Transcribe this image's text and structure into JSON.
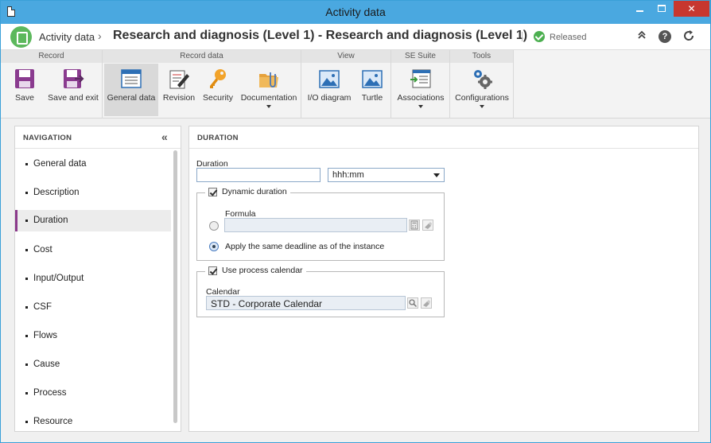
{
  "window": {
    "title": "Activity data"
  },
  "header": {
    "breadcrumb_root": "Activity data",
    "breadcrumb_sep": "›",
    "page_title": "Research and diagnosis (Level 1) - Research and diagnosis (Level 1)",
    "status": "Released"
  },
  "ribbon": {
    "groups": {
      "record": "Record",
      "record_data": "Record data",
      "view": "View",
      "se_suite": "SE Suite",
      "tools": "Tools"
    },
    "buttons": {
      "save": "Save",
      "save_exit": "Save and exit",
      "general_data": "General data",
      "revision": "Revision",
      "security": "Security",
      "documentation": "Documentation",
      "io_diagram": "I/O diagram",
      "turtle": "Turtle",
      "associations": "Associations",
      "configurations": "Configurations"
    },
    "active_button": "General data"
  },
  "navigation": {
    "title": "NAVIGATION",
    "collapse_glyph": "«",
    "items": [
      {
        "label": "General data"
      },
      {
        "label": "Description"
      },
      {
        "label": "Duration"
      },
      {
        "label": "Cost"
      },
      {
        "label": "Input/Output"
      },
      {
        "label": "CSF"
      },
      {
        "label": "Flows"
      },
      {
        "label": "Cause"
      },
      {
        "label": "Process"
      },
      {
        "label": "Resource"
      }
    ],
    "active_item": "Duration"
  },
  "content": {
    "title": "DURATION",
    "duration_label": "Duration",
    "duration_value": "",
    "unit_value": "hhh:mm",
    "dynamic_duration": {
      "label": "Dynamic duration",
      "checked": true
    },
    "formula_label": "Formula",
    "formula_value": "",
    "same_deadline_label": "Apply the same deadline as of the instance",
    "same_deadline_selected": true,
    "use_process_calendar": {
      "label": "Use process calendar",
      "checked": true
    },
    "calendar_label": "Calendar",
    "calendar_value": "STD - Corporate Calendar"
  },
  "colors": {
    "titlebar": "#4aa8e0",
    "close_button": "#c7372f",
    "accent_nav": "#8b3a8b",
    "status_ok": "#4caf50"
  }
}
